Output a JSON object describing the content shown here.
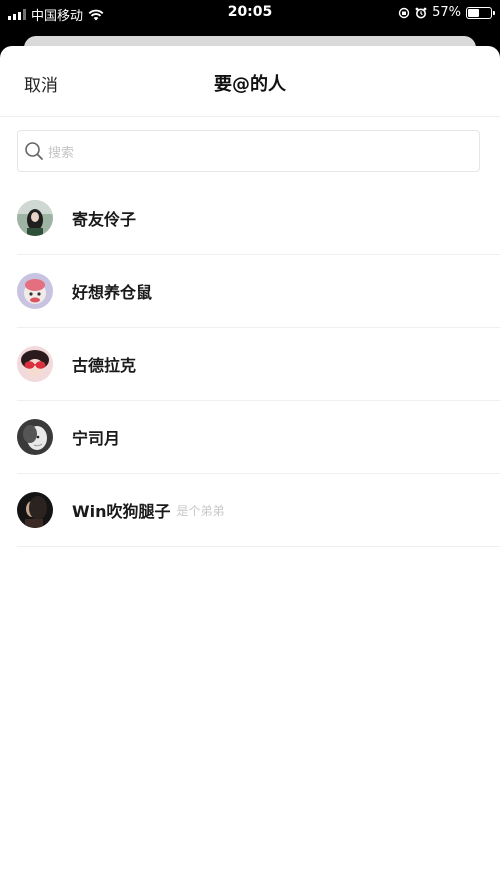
{
  "status_bar": {
    "carrier": "中国移动",
    "time": "20:05",
    "battery_text": "57%",
    "battery_level": 0.57
  },
  "header": {
    "cancel_label": "取消",
    "title": "要@的人"
  },
  "search": {
    "placeholder": "搜索"
  },
  "contacts": [
    {
      "name": "寄友伶子",
      "note": ""
    },
    {
      "name": "好想养仓鼠",
      "note": ""
    },
    {
      "name": "古德拉克",
      "note": ""
    },
    {
      "name": "宁司月",
      "note": ""
    },
    {
      "name": "Win吹狗腿子",
      "note": "是个弟弟"
    }
  ],
  "colors": {
    "background": "#ffffff",
    "separator": "#efefef",
    "text_primary": "#1a1a1a",
    "text_hint": "#c8c8c8"
  }
}
